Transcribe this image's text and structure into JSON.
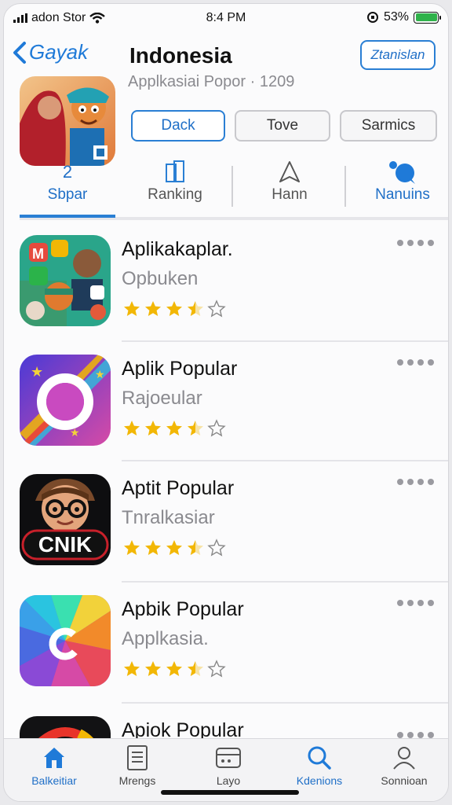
{
  "status_bar": {
    "carrier": "adon Stor",
    "time": "8:4 PM",
    "battery": "53%"
  },
  "header": {
    "back_label": "Gayak",
    "title": "Indonesia",
    "subtitle": "Applkasiai Popor · 1209",
    "action_button": "Ztanislan"
  },
  "segments": [
    {
      "label": "Dack",
      "active": true
    },
    {
      "label": "Tove",
      "active": false
    },
    {
      "label": "Sarmics",
      "active": false
    }
  ],
  "tabs": [
    {
      "top": "2",
      "label": "Sbpar",
      "active": true
    },
    {
      "icon": "book-icon",
      "label": "Ranking"
    },
    {
      "icon": "triangle-icon",
      "label": "Hann"
    },
    {
      "icon": "bubble-icon",
      "label": "Nanuins"
    }
  ],
  "apps": [
    {
      "name": "Aplikakaplar.",
      "category": "Opbuken",
      "rating": 3.5,
      "icon": "collage-app-icon"
    },
    {
      "name": "Aplik Popular",
      "category": "Rajoeular",
      "rating": 3.5,
      "icon": "ring-app-icon"
    },
    {
      "name": "Aptit Popular",
      "category": "Tnralkasiar",
      "rating": 3.5,
      "icon": "cnik-app-icon",
      "icon_text": "CNIK"
    },
    {
      "name": "Apbik Popular",
      "category": "Applkasia.",
      "rating": 3.5,
      "icon": "rainbow-app-icon"
    },
    {
      "name": "Apiok Popular",
      "category": "",
      "rating": 0,
      "icon": "dark-app-icon"
    }
  ],
  "tabbar": [
    {
      "label": "Balkeitiar",
      "icon": "home-icon",
      "active": true
    },
    {
      "label": "Mrengs",
      "icon": "document-icon"
    },
    {
      "label": "Layo",
      "icon": "card-icon"
    },
    {
      "label": "Kdenions",
      "icon": "search-icon",
      "active": true
    },
    {
      "label": "Sonnioan",
      "icon": "person-icon"
    }
  ],
  "colors": {
    "accent": "#1f7ad8",
    "star": "#f2b705",
    "battery": "#2fb24a"
  }
}
